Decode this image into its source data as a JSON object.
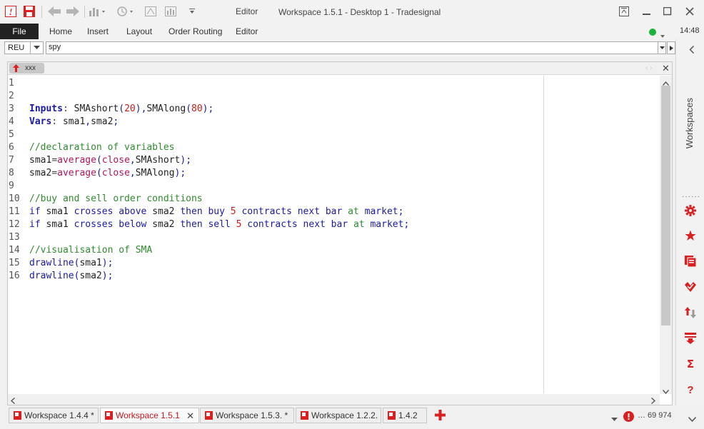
{
  "app": {
    "editor_label": "Editor",
    "window_title": "Workspace 1.5.1 - Desktop 1 - Tradesignal"
  },
  "menubar": {
    "file": "File",
    "items": [
      "Home",
      "Insert",
      "Layout",
      "Order Routing",
      "Editor"
    ],
    "clock": "14:48"
  },
  "symbol_bar": {
    "exchange": "REU",
    "symbol": "spy"
  },
  "document": {
    "tab_label": "xxx",
    "line_numbers": [
      "1",
      "2",
      "3",
      "4",
      "5",
      "6",
      "7",
      "8",
      "9",
      "10",
      "11",
      "12",
      "13",
      "14",
      "15",
      "16"
    ]
  },
  "right_panel": {
    "label": "Workspaces",
    "icons": [
      "gear-icon",
      "star-icon",
      "document-icon",
      "check-icon",
      "updown-arrows-icon",
      "download-icon",
      "sigma-icon",
      "help-icon"
    ]
  },
  "workspace_tabs": [
    {
      "label": "Workspace 1.4.4 *",
      "active": false
    },
    {
      "label": "Workspace 1.5.1",
      "active": true
    },
    {
      "label": "Workspace 1.5.3. *",
      "active": false
    },
    {
      "label": "Workspace 1.2.2.",
      "active": false
    },
    {
      "label": "1.4.2",
      "active": false
    }
  ],
  "status": {
    "counter": "69 974"
  },
  "colors": {
    "accent": "#d91f1f",
    "keyword": "#1a1aa6",
    "comment": "#2e8b2e",
    "number": "#c81e1e",
    "online": "#1db33a"
  }
}
